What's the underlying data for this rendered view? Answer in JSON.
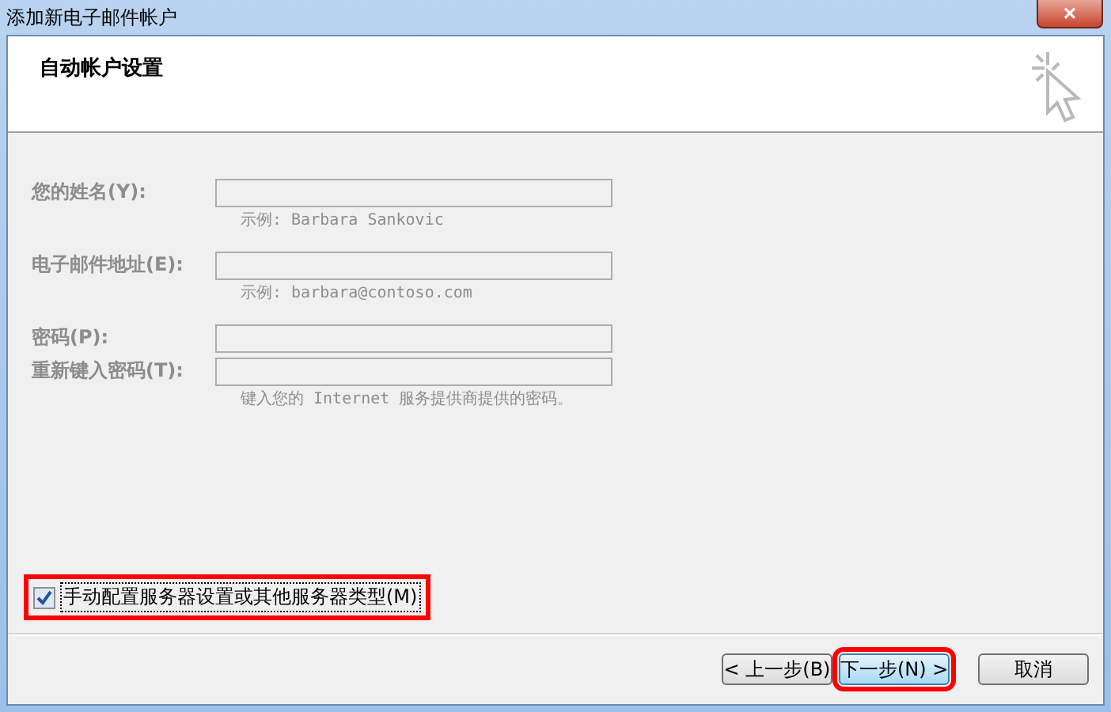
{
  "window": {
    "title": "添加新电子邮件帐户",
    "close": "×"
  },
  "header": {
    "title": "自动帐户设置"
  },
  "form": {
    "disabled": true,
    "fields": [
      {
        "label": "您的姓名(Y):",
        "hint": "示例: Barbara Sankovic"
      },
      {
        "label": "电子邮件地址(E):",
        "hint": "示例: barbara@contoso.com"
      },
      {
        "label": "密码(P):"
      },
      {
        "label": "重新键入密码(T):",
        "hint": "键入您的 Internet 服务提供商提供的密码。"
      }
    ]
  },
  "manual_option": {
    "label": "手动配置服务器设置或其他服务器类型(M)",
    "checked": true,
    "highlighted": true
  },
  "buttons": [
    {
      "label": "< 上一步(B)",
      "focused": false,
      "highlighted": false
    },
    {
      "label": "下一步(N) >",
      "focused": true,
      "highlighted": true
    },
    {
      "label": "取消",
      "focused": false,
      "highlighted": false
    }
  ]
}
